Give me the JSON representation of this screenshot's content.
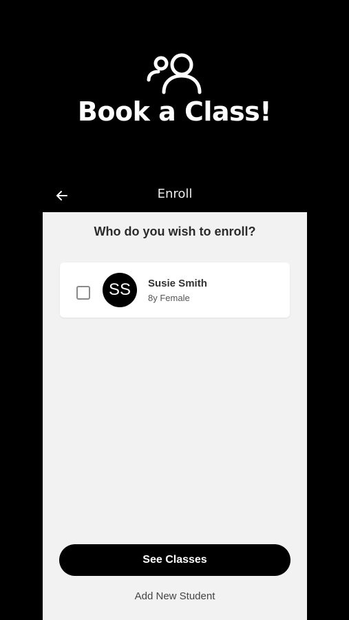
{
  "header": {
    "icon": "users-icon",
    "title": "Book a Class!"
  },
  "topbar": {
    "back_icon": "arrow-left-icon",
    "title": "Enroll"
  },
  "enroll": {
    "question": "Who do you wish to enroll?",
    "students": [
      {
        "initials": "SS",
        "name": "Susie Smith",
        "meta": "8y Female",
        "checked": false
      }
    ]
  },
  "actions": {
    "see_classes_label": "See Classes",
    "add_student_label": "Add New Student"
  },
  "colors": {
    "background": "#000000",
    "panel": "#f2f2f2",
    "card": "#ffffff",
    "primary_button": "#000000",
    "avatar": "#000000"
  }
}
